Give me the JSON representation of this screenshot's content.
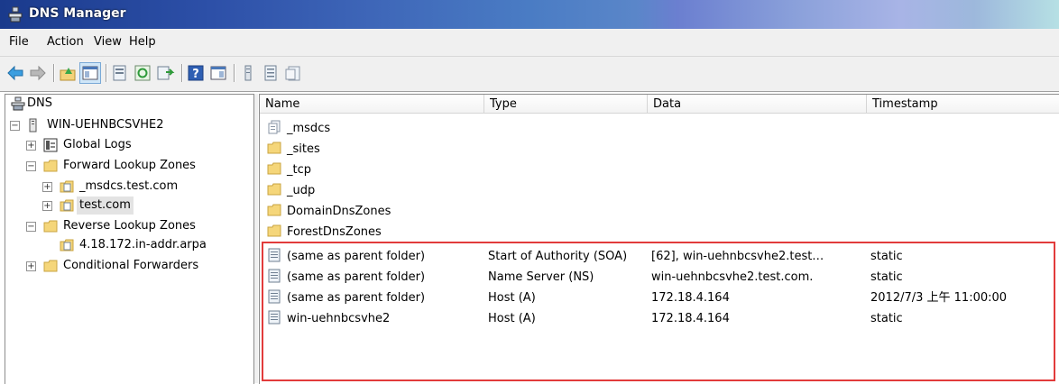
{
  "window": {
    "title": "DNS Manager",
    "icon": "dns-manager-icon"
  },
  "menu": [
    "File",
    "Action",
    "View",
    "Help"
  ],
  "toolbar": {
    "buttons": [
      "back-icon",
      "forward-icon",
      "up-folder-icon",
      "show-hide-tree-icon",
      "properties-icon",
      "refresh-icon",
      "export-list-icon",
      "help-icon",
      "show-hide-action-icon",
      "new-record-icon",
      "new-list-icon",
      "new-zone-icon"
    ]
  },
  "tree": {
    "root": "DNS",
    "server": "WIN-UEHNBCSVHE2",
    "global_logs": "Global Logs",
    "forward_zones": "Forward Lookup Zones",
    "msdcs_zone": "_msdcs.test.com",
    "test_zone": "test.com",
    "reverse_zones": "Reverse Lookup Zones",
    "reverse_zone": "4.18.172.in-addr.arpa",
    "conditional_forwarders": "Conditional Forwarders"
  },
  "list": {
    "columns": {
      "name": "Name",
      "type": "Type",
      "data": "Data",
      "timestamp": "Timestamp"
    },
    "folders": [
      {
        "name": "_msdcs",
        "icon": "delegated-zone-icon"
      },
      {
        "name": "_sites",
        "icon": "folder-icon"
      },
      {
        "name": "_tcp",
        "icon": "folder-icon"
      },
      {
        "name": "_udp",
        "icon": "folder-icon"
      },
      {
        "name": "DomainDnsZones",
        "icon": "folder-icon"
      },
      {
        "name": "ForestDnsZones",
        "icon": "folder-icon"
      }
    ],
    "records": [
      {
        "name": "(same as parent folder)",
        "type": "Start of Authority (SOA)",
        "data": "[62], win-uehnbcsvhe2.test…",
        "timestamp": "static"
      },
      {
        "name": "(same as parent folder)",
        "type": "Name Server (NS)",
        "data": "win-uehnbcsvhe2.test.com.",
        "timestamp": "static"
      },
      {
        "name": "(same as parent folder)",
        "type": "Host (A)",
        "data": "172.18.4.164",
        "timestamp": "2012/7/3 上午 11:00:00"
      },
      {
        "name": "win-uehnbcsvhe2",
        "type": "Host (A)",
        "data": "172.18.4.164",
        "timestamp": "static"
      }
    ]
  },
  "colors": {
    "highlight_box": "#e23b3b",
    "folder": "#f5d67a"
  }
}
